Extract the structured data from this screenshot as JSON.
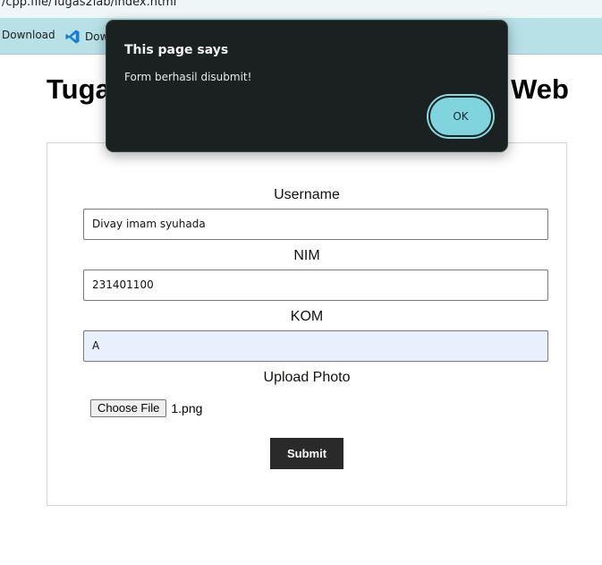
{
  "browser": {
    "address_text": "/cpp.file/Tugas2lab/index.html",
    "bookmarks": [
      {
        "label": "Download",
        "icon": "none"
      },
      {
        "label": "Dow",
        "icon": "vscode-icon"
      }
    ]
  },
  "page": {
    "title_left": "Tuga",
    "title_right": "Web"
  },
  "form": {
    "username_label": "Username",
    "username_value": "Divay imam syuhada",
    "nim_label": "NIM",
    "nim_value": "231401100",
    "kom_label": "KOM",
    "kom_value": "A",
    "upload_label": "Upload Photo",
    "choose_file_label": "Choose File",
    "file_name": "1.png",
    "submit_label": "Submit"
  },
  "dialog": {
    "title": "This page says",
    "message": "Form berhasil disubmit!",
    "ok_label": "OK"
  },
  "colors": {
    "bookmark_bar": "#b7e1e6",
    "dialog_bg": "#1b2121",
    "ok_button": "#7fd4de",
    "submit_button": "#2a2a2a",
    "autofill_bg": "#e8f0fe"
  }
}
